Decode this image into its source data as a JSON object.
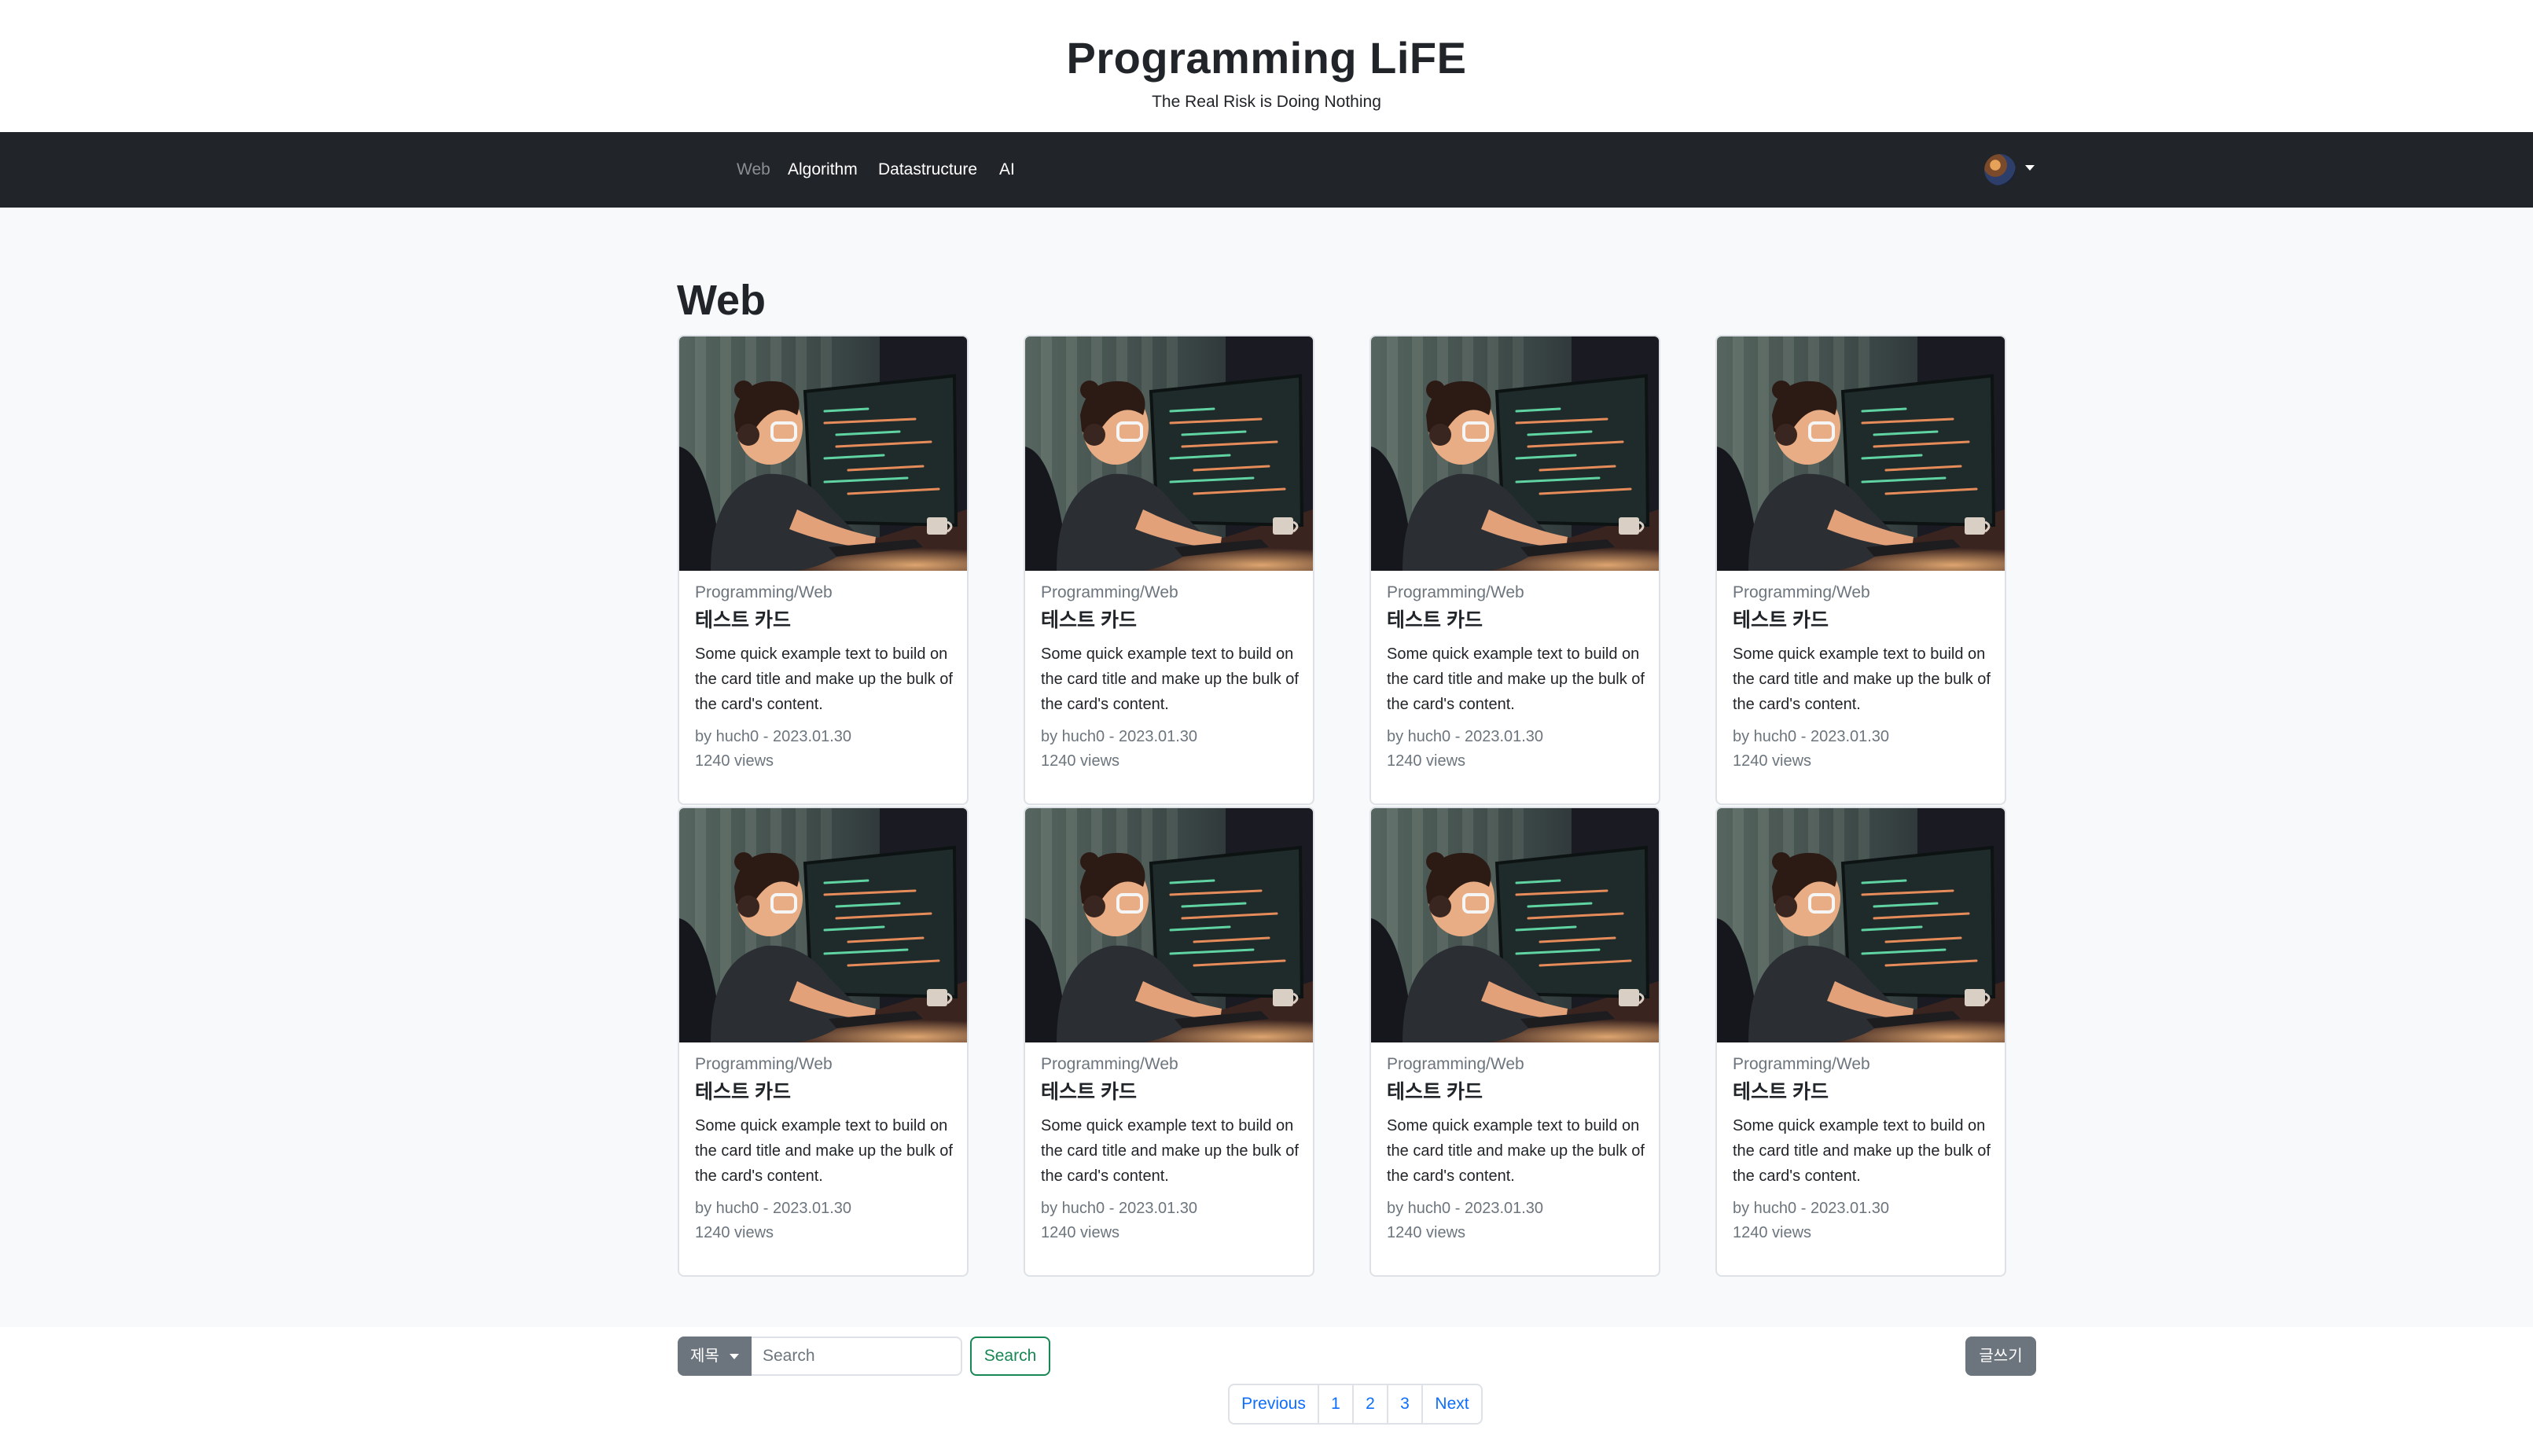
{
  "header": {
    "title": "Programming LiFE",
    "tagline": "The Real Risk is Doing Nothing"
  },
  "nav": {
    "items": [
      {
        "label": "Web",
        "active": true
      },
      {
        "label": "Algorithm",
        "active": false
      },
      {
        "label": "Datastructure",
        "active": false
      },
      {
        "label": "AI",
        "active": false
      }
    ],
    "avatar_icon": "user-avatar-icon",
    "dropdown_icon": "caret-down-icon"
  },
  "main": {
    "heading": "Web",
    "cards": [
      {
        "subtitle": "Programming/Web",
        "title": "테스트 카드",
        "text": "Some quick example text to build on the card title and make up the bulk of the card's content.",
        "meta": "by huch0 - 2023.01.30",
        "views": "1240 views"
      },
      {
        "subtitle": "Programming/Web",
        "title": "테스트 카드",
        "text": "Some quick example text to build on the card title and make up the bulk of the card's content.",
        "meta": "by huch0 - 2023.01.30",
        "views": "1240 views"
      },
      {
        "subtitle": "Programming/Web",
        "title": "테스트 카드",
        "text": "Some quick example text to build on the card title and make up the bulk of the card's content.",
        "meta": "by huch0 - 2023.01.30",
        "views": "1240 views"
      },
      {
        "subtitle": "Programming/Web",
        "title": "테스트 카드",
        "text": "Some quick example text to build on the card title and make up the bulk of the card's content.",
        "meta": "by huch0 - 2023.01.30",
        "views": "1240 views"
      },
      {
        "subtitle": "Programming/Web",
        "title": "테스트 카드",
        "text": "Some quick example text to build on the card title and make up the bulk of the card's content.",
        "meta": "by huch0 - 2023.01.30",
        "views": "1240 views"
      },
      {
        "subtitle": "Programming/Web",
        "title": "테스트 카드",
        "text": "Some quick example text to build on the card title and make up the bulk of the card's content.",
        "meta": "by huch0 - 2023.01.30",
        "views": "1240 views"
      },
      {
        "subtitle": "Programming/Web",
        "title": "테스트 카드",
        "text": "Some quick example text to build on the card title and make up the bulk of the card's content.",
        "meta": "by huch0 - 2023.01.30",
        "views": "1240 views"
      },
      {
        "subtitle": "Programming/Web",
        "title": "테스트 카드",
        "text": "Some quick example text to build on the card title and make up the bulk of the card's content.",
        "meta": "by huch0 - 2023.01.30",
        "views": "1240 views"
      }
    ]
  },
  "search": {
    "filter_label": "제목",
    "placeholder": "Search",
    "button_label": "Search"
  },
  "write_button": "글쓰기",
  "pagination": {
    "previous": "Previous",
    "pages": [
      "1",
      "2",
      "3"
    ],
    "next": "Next"
  },
  "colors": {
    "navbar_bg": "#212529",
    "page_bg": "#f8f9fa",
    "secondary": "#6c757d",
    "success": "#198754",
    "link": "#0d6efd"
  }
}
